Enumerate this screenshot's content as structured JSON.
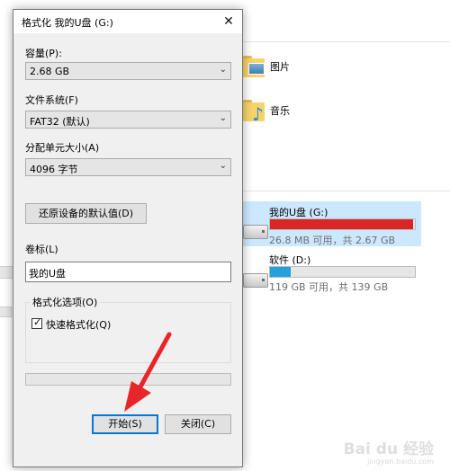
{
  "explorer": {
    "folders": [
      {
        "label": "图片",
        "icon": "pictures-folder-icon"
      },
      {
        "label": "音乐",
        "icon": "music-folder-icon"
      }
    ],
    "drives": [
      {
        "name": "我的U盘 (G:)",
        "free_text": "26.8 MB 可用，共 2.67 GB",
        "used_fraction": 0.99,
        "bar_color": "#da2626",
        "selected": true
      },
      {
        "name": "软件 (D:)",
        "free_text": "119 GB 可用，共 139 GB",
        "used_fraction": 0.14,
        "bar_color": "#26a0da",
        "selected": false
      }
    ]
  },
  "dialog": {
    "title": "格式化 我的U盘 (G:)",
    "close_glyph": "✕",
    "capacity_label": "容量(P):",
    "capacity_value": "2.68 GB",
    "filesystem_label": "文件系统(F)",
    "filesystem_value": "FAT32 (默认)",
    "unit_label": "分配单元大小(A)",
    "unit_value": "4096 字节",
    "restore_button": "还原设备的默认值(D)",
    "volume_label": "卷标(L)",
    "volume_value": "我的U盘",
    "options_group": "格式化选项(O)",
    "quick_format_label": "快速格式化(Q)",
    "quick_format_checked": true,
    "progress": 0,
    "start_button": "开始(S)",
    "close_button": "关闭(C)",
    "chevron_glyph": "⌄"
  },
  "watermark": {
    "line1": "Bai du 经验",
    "line2": "jingyan.baidu.com"
  },
  "colors": {
    "accent": "#0078d7",
    "annotation_arrow": "#e8262a"
  }
}
